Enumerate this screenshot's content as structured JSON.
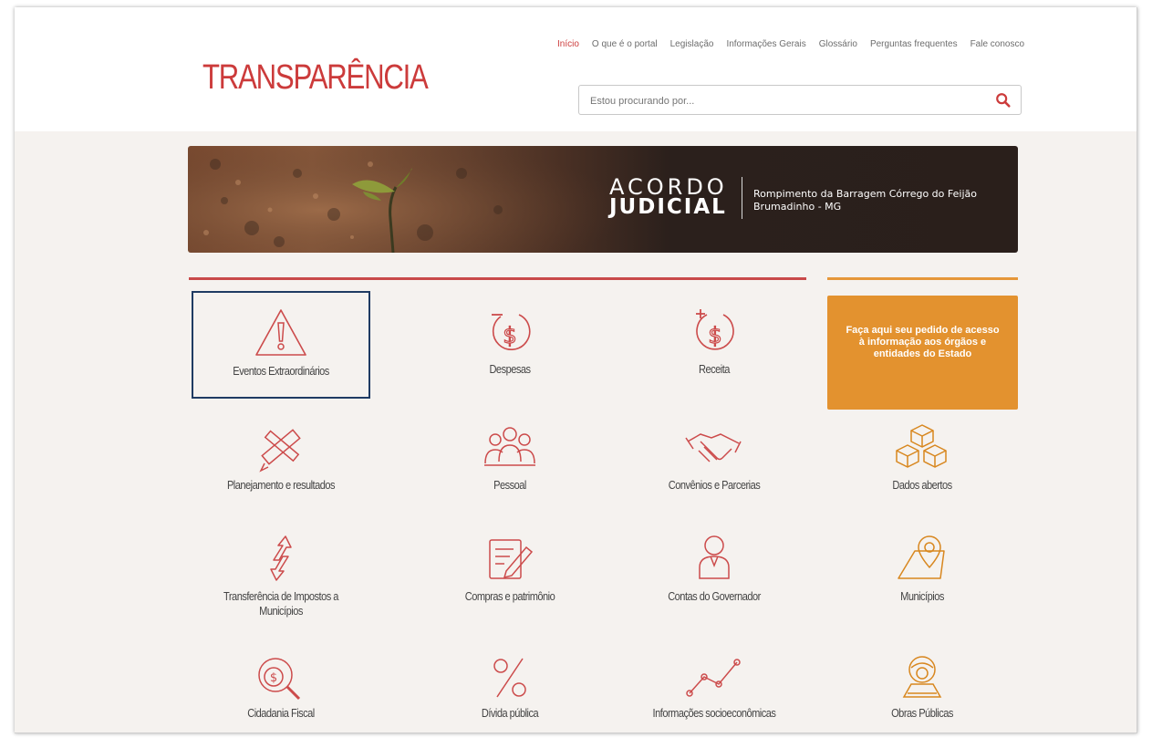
{
  "header": {
    "logo_text": "TRANSPARÊNCIA",
    "nav": [
      "Início",
      "O que é o portal",
      "Legislação",
      "Informações Gerais",
      "Glossário",
      "Perguntas frequentes",
      "Fale conosco"
    ],
    "search_placeholder": "Estou procurando por..."
  },
  "banner": {
    "title_line1": "ACORDO",
    "title_line2": "JUDICIAL",
    "desc_line1": "Rompimento da Barragem Córrego do Feijão",
    "desc_line2": "Brumadinho - MG"
  },
  "cta": {
    "text": "Faça aqui seu pedido de acesso à informação aos órgãos e entidades do Estado"
  },
  "tiles": [
    {
      "label": "Eventos Extraordinários",
      "icon": "warning-icon"
    },
    {
      "label": "Despesas",
      "icon": "money-minus-icon"
    },
    {
      "label": "Receita",
      "icon": "money-plus-icon"
    },
    {
      "label": "Planejamento e resultados",
      "icon": "pencil-ruler-icon"
    },
    {
      "label": "Pessoal",
      "icon": "people-icon"
    },
    {
      "label": "Convênios e Parcerias",
      "icon": "handshake-icon"
    },
    {
      "label": "Dados abertos",
      "icon": "boxes-icon"
    },
    {
      "label": "Transferência de Impostos a Municípios",
      "icon": "transfer-arrows-icon"
    },
    {
      "label": "Compras e patrimônio",
      "icon": "document-edit-icon"
    },
    {
      "label": "Contas do Governador",
      "icon": "governor-icon"
    },
    {
      "label": "Municípios",
      "icon": "map-pin-icon"
    },
    {
      "label": "Cidadania Fiscal",
      "icon": "magnifier-coin-icon"
    },
    {
      "label": "Dívida pública",
      "icon": "percent-icon"
    },
    {
      "label": "Informações socioeconômicas",
      "icon": "line-chart-icon"
    },
    {
      "label": "Obras Públicas",
      "icon": "construction-icon"
    }
  ],
  "colors": {
    "brand_red": "#cc3b3b",
    "accent_orange": "#e3922f",
    "selection_border": "#1f3b63"
  }
}
